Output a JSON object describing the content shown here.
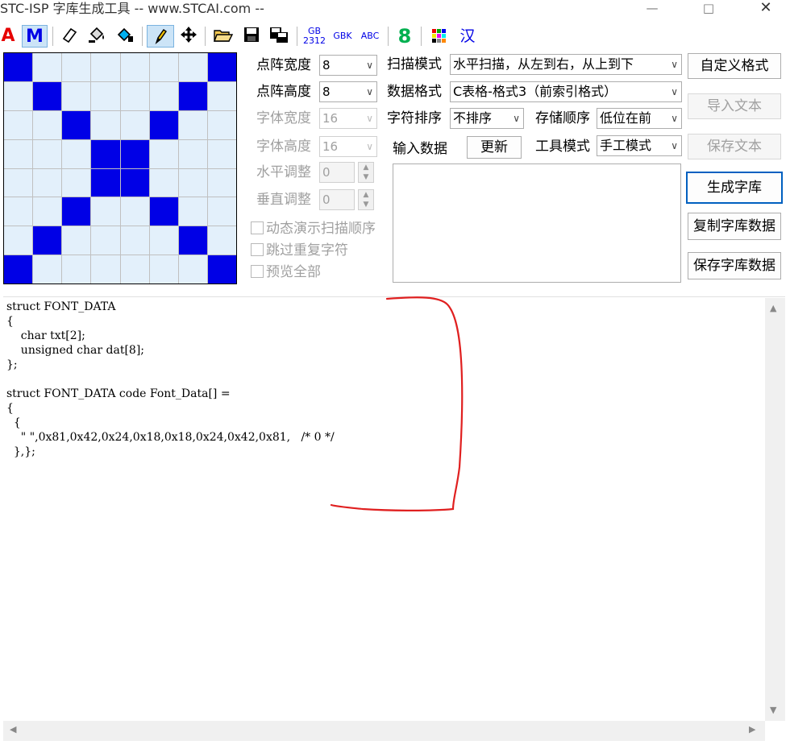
{
  "window": {
    "title": "STC-ISP 字库生成工具 -- www.STCAI.com --",
    "minimize_glyph": "—",
    "maximize_glyph": "□",
    "close_glyph": "✕"
  },
  "toolbar": {
    "text_A": "A",
    "text_M": "M",
    "gb2312_top": "GB",
    "gb2312_bottom": "2312",
    "gbk": "GBK",
    "abc": "ABC",
    "eight": "8",
    "han": "汉",
    "colors": {
      "A": "#e60000",
      "M": "#0000e6",
      "eight": "#00b050",
      "han": "#0000e6",
      "gb": "#0000e6"
    }
  },
  "grid": {
    "cols": 8,
    "rows": 8,
    "pattern": [
      [
        1,
        0,
        0,
        0,
        0,
        0,
        0,
        1
      ],
      [
        0,
        1,
        0,
        0,
        0,
        0,
        1,
        0
      ],
      [
        0,
        0,
        1,
        0,
        0,
        1,
        0,
        0
      ],
      [
        0,
        0,
        0,
        1,
        1,
        0,
        0,
        0
      ],
      [
        0,
        0,
        0,
        1,
        1,
        0,
        0,
        0
      ],
      [
        0,
        0,
        1,
        0,
        0,
        1,
        0,
        0
      ],
      [
        0,
        1,
        0,
        0,
        0,
        0,
        1,
        0
      ],
      [
        1,
        0,
        0,
        0,
        0,
        0,
        0,
        1
      ]
    ],
    "on_color": "#0000e6",
    "off_color": "#e3f0fb"
  },
  "settings": {
    "dot_width_label": "点阵宽度",
    "dot_width_value": "8",
    "dot_height_label": "点阵高度",
    "dot_height_value": "8",
    "font_width_label": "字体宽度",
    "font_width_value": "16",
    "font_height_label": "字体高度",
    "font_height_value": "16",
    "h_adjust_label": "水平调整",
    "h_adjust_value": "0",
    "v_adjust_label": "垂直调整",
    "v_adjust_value": "0",
    "scan_mode_label": "扫描模式",
    "scan_mode_value": "水平扫描，从左到右，从上到下",
    "data_format_label": "数据格式",
    "data_format_value": "C表格-格式3（前索引格式）",
    "char_order_label": "字符排序",
    "char_order_value": "不排序",
    "storage_order_label": "存储顺序",
    "storage_order_value": "低位在前",
    "input_data_label": "输入数据",
    "refresh_label": "更新",
    "tool_mode_label": "工具模式",
    "tool_mode_value": "手工模式"
  },
  "checkboxes": {
    "dynamic_scan": "动态演示扫描顺序",
    "skip_duplicate": "跳过重复字符",
    "preview_all": "预览全部"
  },
  "buttons": {
    "custom_format": "自定义格式",
    "import_text": "导入文本",
    "save_text": "保存文本",
    "generate": "生成字库",
    "copy_data": "复制字库数据",
    "save_data": "保存字库数据"
  },
  "code": {
    "text": "struct FONT_DATA\n{\n    char txt[2];\n    unsigned char dat[8];\n};\n\nstruct FONT_DATA code Font_Data[] =\n{\n  {\n    \" \",0x81,0x42,0x24,0x18,0x18,0x24,0x42,0x81,   /* 0 */\n  },};"
  },
  "annotation": {
    "color": "#e02020"
  }
}
